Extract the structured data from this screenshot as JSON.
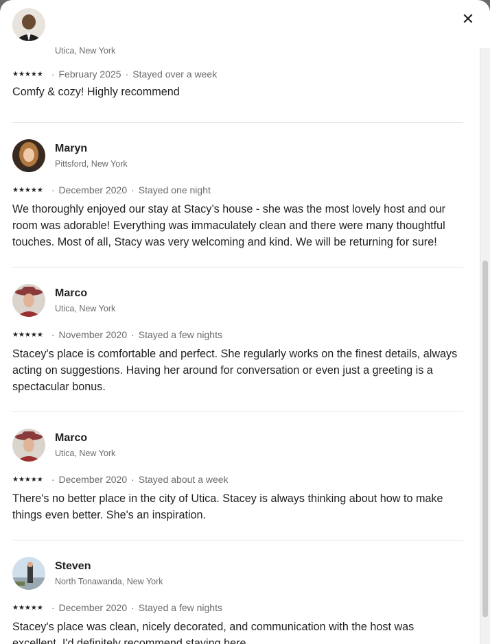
{
  "close_label": "✕",
  "star_glyphs": "★★★★★",
  "reviews": [
    {
      "name": "",
      "location": "Utica, New York",
      "date": "February 2025",
      "stay": "Stayed over a week",
      "text": "Comfy & cozy! Highly recommend"
    },
    {
      "name": "Maryn",
      "location": "Pittsford, New York",
      "date": "December 2020",
      "stay": "Stayed one night",
      "text": "We thoroughly enjoyed our stay at Stacy’s house - she was the most lovely host and our room was adorable! Everything was immaculately clean and there were many thoughtful touches. Most of all, Stacy was very welcoming and kind. We will be returning for sure!"
    },
    {
      "name": "Marco",
      "location": "Utica, New York",
      "date": "November 2020",
      "stay": "Stayed a few nights",
      "text": "Stacey's place is comfortable and perfect.  She regularly works on the finest details, always acting on suggestions.  Having her around for conversation or even just a greeting is a spectacular bonus."
    },
    {
      "name": "Marco",
      "location": "Utica, New York",
      "date": "December 2020",
      "stay": "Stayed about a week",
      "text": "There's no better place in the city of Utica.  Stacey is always thinking about how to make things even better.  She's an inspiration."
    },
    {
      "name": "Steven",
      "location": "North Tonawanda, New York",
      "date": "December 2020",
      "stay": "Stayed a few nights",
      "text": "Stacey's place was clean, nicely decorated, and communication with the host was excellent. I'd definitely recommend staying here."
    }
  ]
}
